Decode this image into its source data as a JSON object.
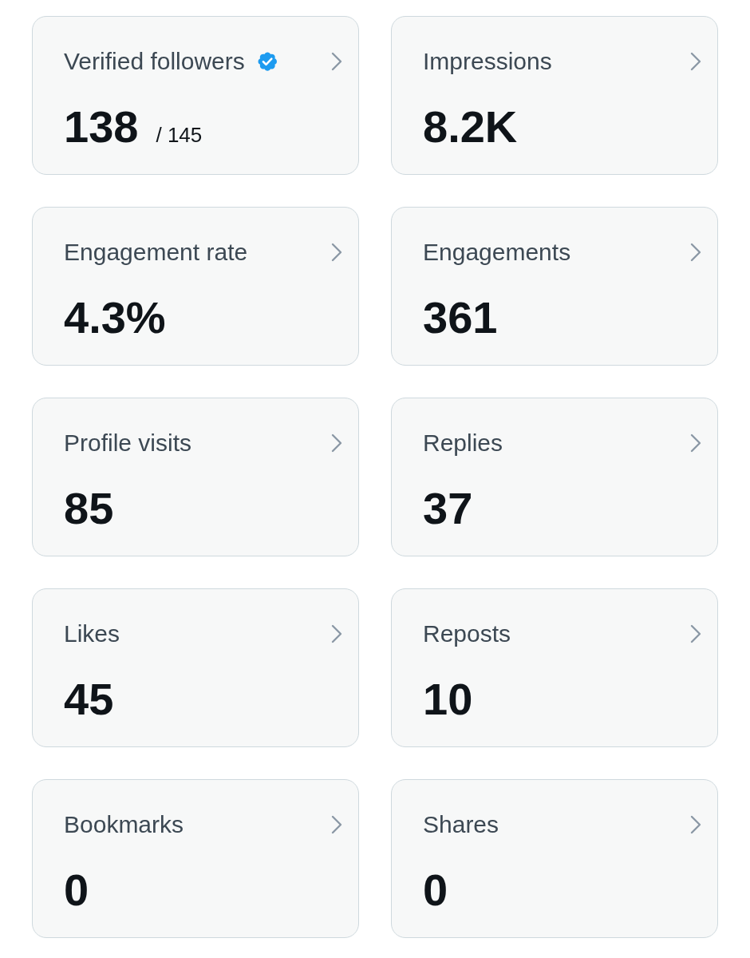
{
  "metrics": [
    {
      "label": "Verified followers",
      "verified": true,
      "value": "138",
      "total": "/ 145"
    },
    {
      "label": "Impressions",
      "verified": false,
      "value": "8.2K"
    },
    {
      "label": "Engagement rate",
      "verified": false,
      "value": "4.3%"
    },
    {
      "label": "Engagements",
      "verified": false,
      "value": "361"
    },
    {
      "label": "Profile visits",
      "verified": false,
      "value": "85"
    },
    {
      "label": "Replies",
      "verified": false,
      "value": "37"
    },
    {
      "label": "Likes",
      "verified": false,
      "value": "45"
    },
    {
      "label": "Reposts",
      "verified": false,
      "value": "10"
    },
    {
      "label": "Bookmarks",
      "verified": false,
      "value": "0"
    },
    {
      "label": "Shares",
      "verified": false,
      "value": "0"
    }
  ]
}
